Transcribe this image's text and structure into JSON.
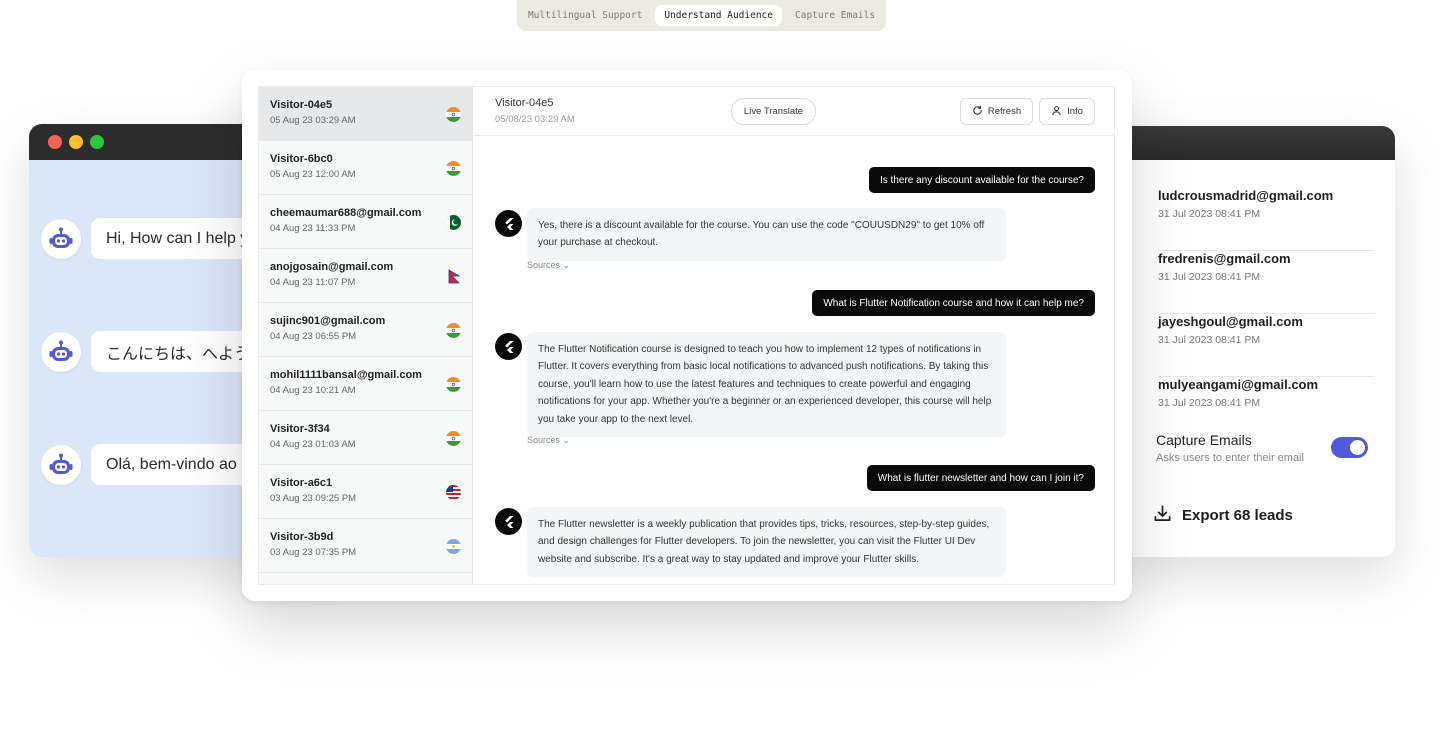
{
  "tabs": [
    {
      "label": "Multilingual Support",
      "active": false
    },
    {
      "label": "Understand Audience",
      "active": true
    },
    {
      "label": "Capture Emails",
      "active": false
    }
  ],
  "left_window": {
    "greetings": [
      "Hi, How can I help you?",
      "こんにちは、へようこそ",
      "Olá, bem-vindo ao nosso site"
    ]
  },
  "visitors": [
    {
      "name": "Visitor-04e5",
      "time": "05 Aug 23 03:29 AM",
      "flag": "india",
      "selected": true
    },
    {
      "name": "Visitor-6bc0",
      "time": "05 Aug 23 12:00 AM",
      "flag": "india"
    },
    {
      "name": "cheemaumar688@gmail.com",
      "time": "04 Aug 23 11:33 PM",
      "flag": "pakistan"
    },
    {
      "name": "anojgosain@gmail.com",
      "time": "04 Aug 23 11:07 PM",
      "flag": "nepal"
    },
    {
      "name": "sujinc901@gmail.com",
      "time": "04 Aug 23 06:55 PM",
      "flag": "india"
    },
    {
      "name": "mohil1111bansal@gmail.com",
      "time": "04 Aug 23 10:21 AM",
      "flag": "india"
    },
    {
      "name": "Visitor-3f34",
      "time": "04 Aug 23 01:03 AM",
      "flag": "india"
    },
    {
      "name": "Visitor-a6c1",
      "time": "03 Aug 23 09:25 PM",
      "flag": "usa"
    },
    {
      "name": "Visitor-3b9d",
      "time": "03 Aug 23 07:35 PM",
      "flag": "argentina"
    }
  ],
  "chat": {
    "header": {
      "name": "Visitor-04e5",
      "time": "05/08/23 03:29 AM",
      "live_translate": "Live Translate",
      "refresh": "Refresh",
      "info": "Info"
    },
    "sources_label": "Sources",
    "messages": [
      {
        "role": "user",
        "text": "Is there any discount available for the course?"
      },
      {
        "role": "bot",
        "text": "Yes, there is a discount available for the course. You can use the code \"COUUSDN29\" to get 10% off your purchase at checkout."
      },
      {
        "role": "user",
        "text": "What is Flutter Notification course and how it can help me?"
      },
      {
        "role": "bot",
        "text": "The Flutter Notification course is designed to teach you how to implement 12 types of notifications in Flutter. It covers everything from basic local notifications to advanced push notifications. By taking this course, you'll learn how to use the latest features and techniques to create powerful and engaging notifications for your app. Whether you're a beginner or an experienced developer, this course will help you take your app to the next level."
      },
      {
        "role": "user",
        "text": "What is flutter newsletter and how can I join it?"
      },
      {
        "role": "bot",
        "text": "The Flutter newsletter is a weekly publication that provides tips, tricks, resources, step-by-step guides, and design challenges for Flutter developers. To join the newsletter, you can visit the Flutter UI Dev website and subscribe. It's a great way to stay updated and improve your Flutter skills."
      }
    ]
  },
  "leads": [
    {
      "email": "ludcrousmadrid@gmail.com",
      "date": "31 Jul 2023 08:41 PM"
    },
    {
      "email": "fredrenis@gmail.com",
      "date": "31 Jul 2023 08:41 PM"
    },
    {
      "email": "jayeshgoul@gmail.com",
      "date": "31 Jul 2023 08:41 PM"
    },
    {
      "email": "mulyeangami@gmail.com",
      "date": "31 Jul 2023 08:41 PM"
    }
  ],
  "capture": {
    "title": "Capture Emails",
    "subtitle": "Asks users to enter their email",
    "enabled": true
  },
  "export_label": "Export 68 leads",
  "colors": {
    "accent": "#4f5bd5",
    "bot_avatar": "#4f5bd5",
    "left_window_bg": "#dce6f9",
    "tab_bar_bg": "#ecebe2"
  }
}
